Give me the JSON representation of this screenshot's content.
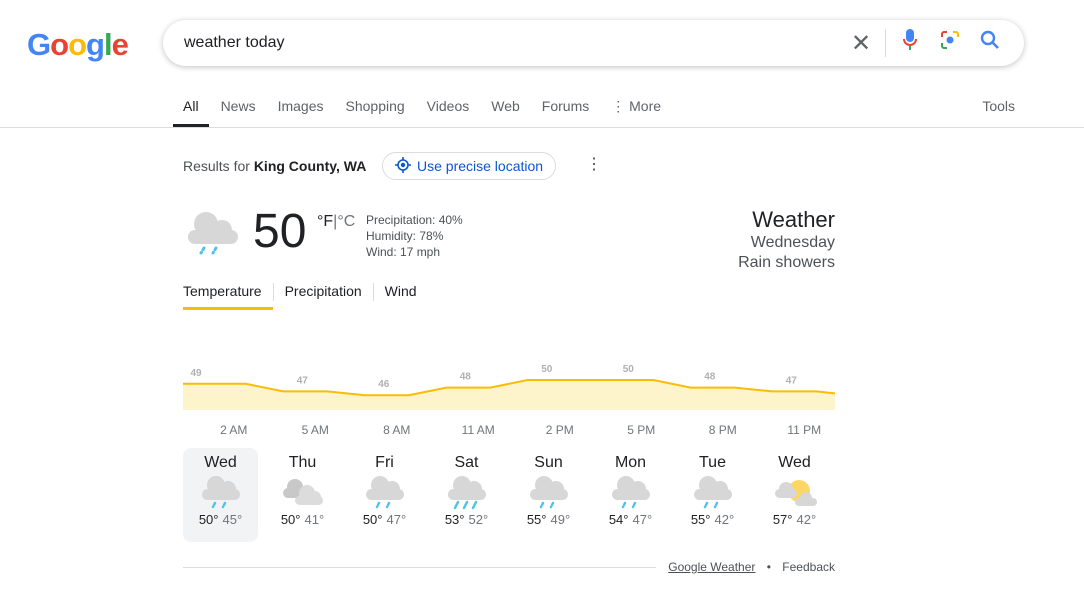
{
  "logo": "Google",
  "search": {
    "query": "weather today"
  },
  "tabs": [
    "All",
    "News",
    "Images",
    "Shopping",
    "Videos",
    "Web",
    "Forums",
    "⋮ More"
  ],
  "tools": "Tools",
  "results": {
    "prefix": "Results for ",
    "location": "King County, WA",
    "precise": "Use precise location"
  },
  "current": {
    "temp": "50",
    "unit_f": "°F",
    "unit_c": "°C",
    "precip": "Precipitation: 40%",
    "humidity": "Humidity: 78%",
    "wind": "Wind: 17 mph",
    "icon": "rain-showers"
  },
  "summary": {
    "title": "Weather",
    "day": "Wednesday",
    "condition": "Rain showers"
  },
  "weather_tabs": [
    "Temperature",
    "Precipitation",
    "Wind"
  ],
  "accent": "#fbbc04",
  "chart_data": {
    "type": "area",
    "categories": [
      "2 AM",
      "5 AM",
      "8 AM",
      "11 AM",
      "2 PM",
      "5 PM",
      "8 PM",
      "11 PM"
    ],
    "values": [
      49,
      47,
      46,
      48,
      50,
      50,
      48,
      47
    ]
  },
  "forecast": [
    {
      "day": "Wed",
      "icon": "rain",
      "hi": "50°",
      "lo": "45°"
    },
    {
      "day": "Thu",
      "icon": "cloudy",
      "hi": "50°",
      "lo": "41°"
    },
    {
      "day": "Fri",
      "icon": "rain",
      "hi": "50°",
      "lo": "47°"
    },
    {
      "day": "Sat",
      "icon": "heavy-rain",
      "hi": "53°",
      "lo": "52°"
    },
    {
      "day": "Sun",
      "icon": "rain",
      "hi": "55°",
      "lo": "49°"
    },
    {
      "day": "Mon",
      "icon": "rain",
      "hi": "54°",
      "lo": "47°"
    },
    {
      "day": "Tue",
      "icon": "rain",
      "hi": "55°",
      "lo": "42°"
    },
    {
      "day": "Wed",
      "icon": "partly-cloudy",
      "hi": "57°",
      "lo": "42°"
    }
  ],
  "footer": {
    "source": "Google Weather",
    "feedback": "Feedback",
    "bullet": "•"
  }
}
